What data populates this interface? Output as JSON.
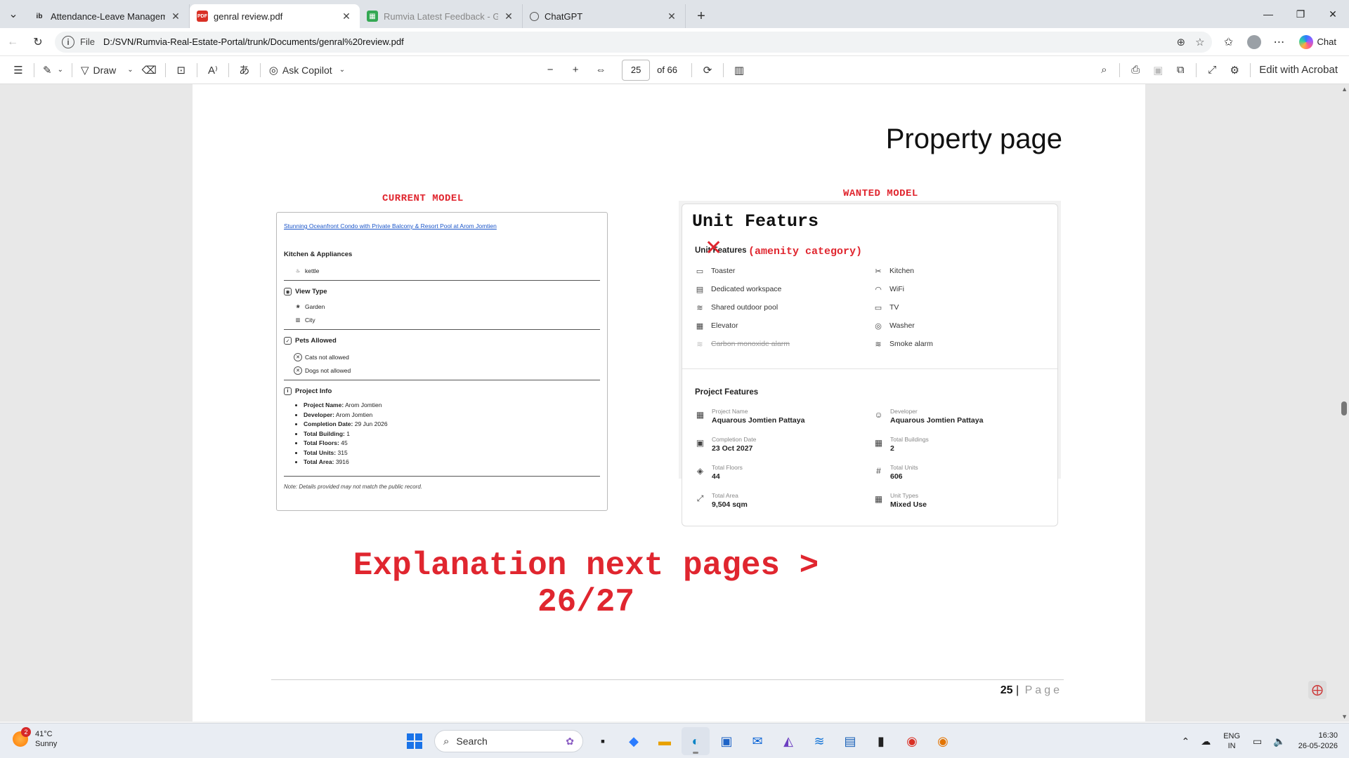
{
  "browser": {
    "tabs": [
      {
        "title": "Attendance-Leave Management Sy",
        "favicon": "ib",
        "active": false
      },
      {
        "title": "genral review.pdf",
        "favicon": "pdf-icon",
        "active": true
      },
      {
        "title": "Rumvia Latest Feedback - Google",
        "favicon": "sheets-icon",
        "active": false
      },
      {
        "title": "ChatGPT",
        "favicon": "chatgpt-icon",
        "active": false
      }
    ],
    "address": {
      "prefix": "File",
      "url": "D:/SVN/Rumvia-Real-Estate-Portal/trunk/Documents/genral%20review.pdf"
    },
    "chat_label": "Chat"
  },
  "pdf_toolbar": {
    "draw_label": "Draw",
    "copilot_label": "Ask Copilot",
    "current_page": "25",
    "total_pages": "of 66",
    "acrobat_label": "Edit with Acrobat"
  },
  "page": {
    "title": "Property page",
    "current_label": "CURRENT MODEL",
    "wanted_label": "WANTED MODEL",
    "explanation": "Explanation next pages > 26/27",
    "page_number": "25",
    "page_word": "Page"
  },
  "current_model": {
    "link": "Stunning Oceanfront Condo with Private Balcony & Resort Pool at Arom Jomtien",
    "kitchen_heading": "Kitchen & Appliances",
    "kitchen_items": [
      "kettle"
    ],
    "view_heading": "View Type",
    "view_items": [
      "Garden",
      "City"
    ],
    "pets_heading": "Pets Allowed",
    "pets_items": [
      "Cats not allowed",
      "Dogs not allowed"
    ],
    "project_heading": "Project Info",
    "project_items": [
      {
        "label": "Project Name:",
        "value": "Arom Jomtien"
      },
      {
        "label": "Developer:",
        "value": "Arom Jomtien"
      },
      {
        "label": "Completion Date:",
        "value": "29 Jun 2026"
      },
      {
        "label": "Total Building:",
        "value": "1"
      },
      {
        "label": "Total Floors:",
        "value": "45"
      },
      {
        "label": "Total Units:",
        "value": "315"
      },
      {
        "label": "Total Area:",
        "value": "3916"
      }
    ],
    "note": "Note: Details provided may not match the public record."
  },
  "wanted_model": {
    "title": "Unit Featurs",
    "subtitle": "Unit Features",
    "annotation": "(amenity category)",
    "features_left": [
      "Toaster",
      "Dedicated workspace",
      "Shared outdoor pool",
      "Elevator",
      "Carbon monoxide alarm"
    ],
    "features_right": [
      "Kitchen",
      "WiFi",
      "TV",
      "Washer",
      "Smoke alarm"
    ],
    "project_heading": "Project Features",
    "project_left": [
      {
        "label": "Project Name",
        "value": "Aquarous Jomtien Pattaya"
      },
      {
        "label": "Completion Date",
        "value": "23 Oct 2027"
      },
      {
        "label": "Total Floors",
        "value": "44"
      },
      {
        "label": "Total Area",
        "value": "9,504 sqm"
      }
    ],
    "project_right": [
      {
        "label": "Developer",
        "value": "Aquarous Jomtien Pattaya"
      },
      {
        "label": "Total Buildings",
        "value": "2"
      },
      {
        "label": "Total Units",
        "value": "606"
      },
      {
        "label": "Unit Types",
        "value": "Mixed Use"
      }
    ]
  },
  "taskbar": {
    "temp": "41°C",
    "condition": "Sunny",
    "badge": "2",
    "search_label": "Search",
    "lang1": "ENG",
    "lang2": "IN",
    "time": "16:30",
    "date": "26-05-2026"
  },
  "colors": {
    "annotation_red": "#e0262f",
    "link_blue": "#1a55c9",
    "windows_blue": "#1a73e8"
  }
}
